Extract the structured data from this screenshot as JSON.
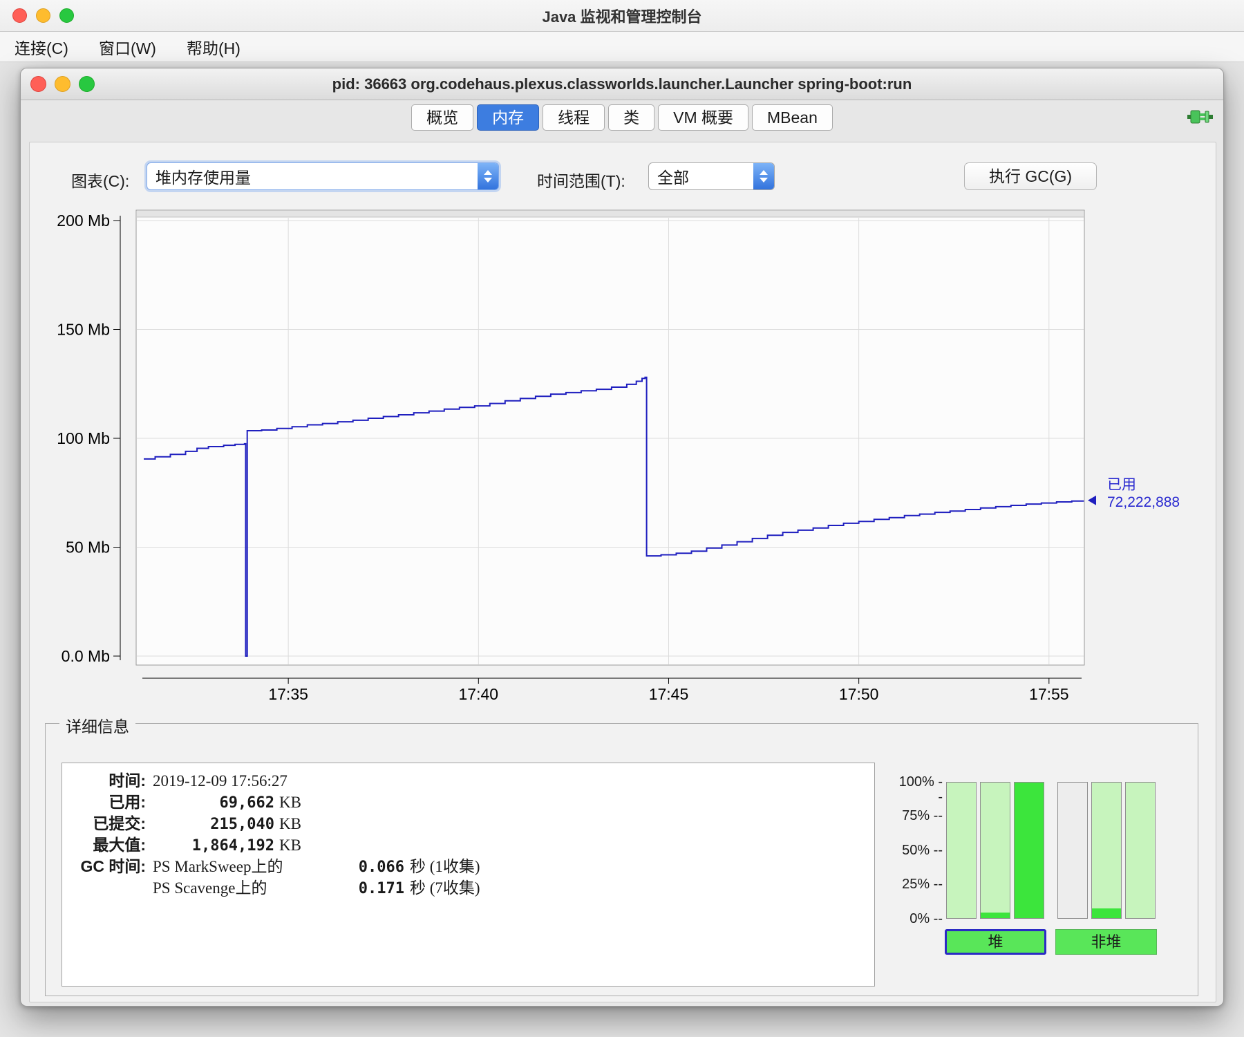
{
  "outer_window": {
    "title": "Java 监视和管理控制台",
    "menu": [
      {
        "label": "连接(C)"
      },
      {
        "label": "窗口(W)"
      },
      {
        "label": "帮助(H)"
      }
    ]
  },
  "inner_window": {
    "title": "pid: 36663 org.codehaus.plexus.classworlds.launcher.Launcher spring-boot:run",
    "tabs": [
      {
        "label": "概览"
      },
      {
        "label": "内存"
      },
      {
        "label": "线程"
      },
      {
        "label": "类"
      },
      {
        "label": "VM 概要"
      },
      {
        "label": "MBean"
      }
    ],
    "active_tab": "内存"
  },
  "controls": {
    "chart_label": "图表(C):",
    "chart_value": "堆内存使用量",
    "range_label": "时间范围(T):",
    "range_value": "全部",
    "gc_button": "执行 GC(G)"
  },
  "chart_data": {
    "type": "line",
    "title": "堆内存使用量",
    "ylabel": "Mb",
    "ylim": [
      0,
      200
    ],
    "grid": true,
    "line_color": "#1f1fbf",
    "y_ticks": [
      {
        "value": 200,
        "label": "200 Mb"
      },
      {
        "value": 150,
        "label": "150 Mb"
      },
      {
        "value": 100,
        "label": "100 Mb"
      },
      {
        "value": 50,
        "label": "50 Mb"
      },
      {
        "value": 0,
        "label": "0.0 Mb"
      }
    ],
    "x_ticks": [
      {
        "minute": 35,
        "label": "17:35"
      },
      {
        "minute": 40,
        "label": "17:40"
      },
      {
        "minute": 45,
        "label": "17:45"
      },
      {
        "minute": 50,
        "label": "17:50"
      },
      {
        "minute": 55,
        "label": "17:55"
      }
    ],
    "x_range_minutes": [
      31.0,
      55.93
    ],
    "series": [
      {
        "name": "已用",
        "points_min_mb": [
          [
            31.2,
            90.5
          ],
          [
            31.5,
            91.5
          ],
          [
            31.9,
            92.6
          ],
          [
            32.3,
            94.0
          ],
          [
            32.6,
            95.4
          ],
          [
            32.9,
            96.2
          ],
          [
            33.3,
            96.8
          ],
          [
            33.6,
            97.2
          ],
          [
            33.85,
            97.5
          ],
          [
            33.88,
            0
          ],
          [
            33.92,
            103.5
          ],
          [
            34.3,
            103.8
          ],
          [
            34.7,
            104.5
          ],
          [
            35.1,
            105.3
          ],
          [
            35.5,
            106.2
          ],
          [
            35.9,
            106.8
          ],
          [
            36.3,
            107.6
          ],
          [
            36.7,
            108.3
          ],
          [
            37.1,
            109.2
          ],
          [
            37.5,
            110.0
          ],
          [
            37.9,
            110.8
          ],
          [
            38.3,
            111.7
          ],
          [
            38.7,
            112.5
          ],
          [
            39.1,
            113.4
          ],
          [
            39.5,
            114.2
          ],
          [
            39.9,
            114.9
          ],
          [
            40.3,
            116.0
          ],
          [
            40.7,
            117.2
          ],
          [
            41.1,
            118.3
          ],
          [
            41.5,
            119.3
          ],
          [
            41.9,
            120.3
          ],
          [
            42.3,
            121.0
          ],
          [
            42.7,
            121.8
          ],
          [
            43.1,
            122.5
          ],
          [
            43.5,
            123.5
          ],
          [
            43.9,
            124.8
          ],
          [
            44.15,
            126.2
          ],
          [
            44.3,
            127.5
          ],
          [
            44.38,
            128.0
          ],
          [
            44.42,
            46.0
          ],
          [
            44.8,
            46.5
          ],
          [
            45.2,
            47.2
          ],
          [
            45.6,
            48.2
          ],
          [
            46.0,
            49.6
          ],
          [
            46.4,
            51.0
          ],
          [
            46.8,
            52.5
          ],
          [
            47.2,
            54.0
          ],
          [
            47.6,
            55.5
          ],
          [
            48.0,
            56.8
          ],
          [
            48.4,
            57.8
          ],
          [
            48.8,
            58.8
          ],
          [
            49.2,
            60.0
          ],
          [
            49.6,
            61.0
          ],
          [
            50.0,
            61.8
          ],
          [
            50.4,
            62.8
          ],
          [
            50.8,
            63.6
          ],
          [
            51.2,
            64.5
          ],
          [
            51.6,
            65.2
          ],
          [
            52.0,
            66.0
          ],
          [
            52.4,
            66.6
          ],
          [
            52.8,
            67.3
          ],
          [
            53.2,
            68.0
          ],
          [
            53.6,
            68.6
          ],
          [
            54.0,
            69.2
          ],
          [
            54.4,
            69.8
          ],
          [
            54.8,
            70.3
          ],
          [
            55.2,
            70.8
          ],
          [
            55.6,
            71.2
          ],
          [
            55.9,
            71.5
          ]
        ]
      }
    ],
    "marker": {
      "name": "已用",
      "value": "72,222,888",
      "at_mb": 71.5
    }
  },
  "details": {
    "legend": "详细信息",
    "rows": [
      {
        "label": "时间:",
        "text": "2019-12-09 17:56:27"
      },
      {
        "label": "已用:",
        "num": "69,662",
        "unit": "KB"
      },
      {
        "label": "已提交:",
        "num": "215,040",
        "unit": "KB"
      },
      {
        "label": "最大值:",
        "num": "1,864,192",
        "unit": "KB"
      },
      {
        "label": "GC 时间:",
        "engine": "PS MarkSweep上的",
        "time": "0.066",
        "rest": "秒 (1收集)"
      },
      {
        "label": "",
        "engine": "PS Scavenge上的",
        "time": "0.171",
        "rest": "秒 (7收集)"
      }
    ]
  },
  "gauges": {
    "scale": [
      {
        "pct": 100,
        "label": "100% --"
      },
      {
        "pct": 75,
        "label": "75% --"
      },
      {
        "pct": 50,
        "label": "50% --"
      },
      {
        "pct": 25,
        "label": "25% --"
      },
      {
        "pct": 0,
        "label": "0% --"
      }
    ],
    "colors": {
      "committed": "#c7f4bd",
      "used": "#3ce53c",
      "empty": "#ededed"
    },
    "bars": [
      {
        "name": "heap-pool-1",
        "committed": true,
        "used_pct": 0
      },
      {
        "name": "heap-pool-2",
        "committed": true,
        "used_pct": 4
      },
      {
        "name": "heap-pool-3",
        "committed": true,
        "used_pct": 100
      },
      {
        "name": "nonheap-pool-1",
        "committed": false,
        "used_pct": 0
      },
      {
        "name": "nonheap-pool-2",
        "committed": true,
        "used_pct": 7
      },
      {
        "name": "nonheap-pool-3",
        "committed": true,
        "used_pct": 0
      }
    ],
    "heap_button": "堆",
    "nonheap_button": "非堆"
  }
}
